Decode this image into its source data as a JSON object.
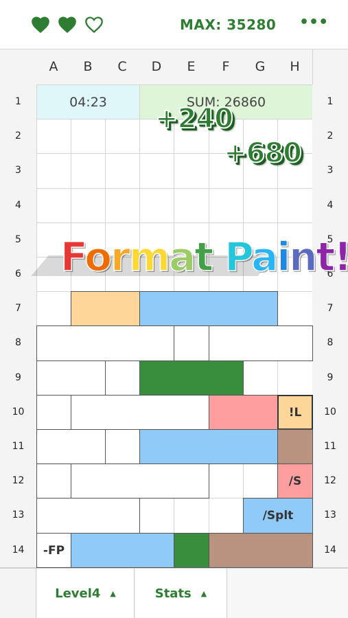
{
  "hearts": [
    {
      "name": "heart-full-icon",
      "filled": true
    },
    {
      "name": "heart-full-icon",
      "filled": true
    },
    {
      "name": "heart-empty-icon",
      "filled": false
    }
  ],
  "max_label": "MAX: 35280",
  "menu_icon": "more-icon",
  "columns": [
    "A",
    "B",
    "C",
    "D",
    "E",
    "F",
    "G",
    "H"
  ],
  "rows": [
    "1",
    "2",
    "3",
    "4",
    "5",
    "6",
    "7",
    "8",
    "9",
    "10",
    "11",
    "12",
    "13",
    "14"
  ],
  "timer": "04:23",
  "sum_label": "SUM: 26860",
  "score_popups": [
    "+240",
    "+680"
  ],
  "banner": {
    "text": "Format Paint!",
    "letters": [
      "F",
      "o",
      "r",
      "m",
      "a",
      "t",
      " ",
      "P",
      "a",
      "i",
      "n",
      "t",
      "!"
    ],
    "colors": [
      "#e53935",
      "#ef6c00",
      "#f9a825",
      "#fdd835",
      "#9ccc65",
      "#43a047",
      "#43a047",
      "#26c6da",
      "#29b6f6",
      "#1e88e5",
      "#5c6bc0",
      "#8e24aa",
      "#8e24aa"
    ]
  },
  "colors": {
    "accent": "#2e7d32",
    "orange": "#ffd699",
    "blue": "#90caf9",
    "green": "#388e3c",
    "pink": "#ff9e9e",
    "brown": "#b9937f",
    "white": "#ffffff",
    "timer_bg": "#e0f7fa",
    "sum_bg": "#dff5d8"
  },
  "blocks": [
    {
      "row": 7,
      "col": 2,
      "span": 2,
      "color": "orange",
      "label": ""
    },
    {
      "row": 7,
      "col": 4,
      "span": 4,
      "color": "blue",
      "label": ""
    },
    {
      "row": 8,
      "col": 1,
      "span": 4,
      "color": "white",
      "label": ""
    },
    {
      "row": 8,
      "col": 5,
      "span": 1,
      "color": "white",
      "label": ""
    },
    {
      "row": 8,
      "col": 6,
      "span": 3,
      "color": "white",
      "label": ""
    },
    {
      "row": 9,
      "col": 1,
      "span": 2,
      "color": "white",
      "label": ""
    },
    {
      "row": 9,
      "col": 3,
      "span": 1,
      "color": "white",
      "label": ""
    },
    {
      "row": 9,
      "col": 4,
      "span": 3,
      "color": "green",
      "label": ""
    },
    {
      "row": 10,
      "col": 1,
      "span": 1,
      "color": "white",
      "label": ""
    },
    {
      "row": 10,
      "col": 2,
      "span": 4,
      "color": "white",
      "label": ""
    },
    {
      "row": 10,
      "col": 6,
      "span": 2,
      "color": "pink",
      "label": ""
    },
    {
      "row": 10,
      "col": 8,
      "span": 1,
      "color": "orange",
      "label": "!L",
      "selected": true
    },
    {
      "row": 11,
      "col": 1,
      "span": 2,
      "color": "white",
      "label": ""
    },
    {
      "row": 11,
      "col": 3,
      "span": 1,
      "color": "white",
      "label": ""
    },
    {
      "row": 11,
      "col": 4,
      "span": 4,
      "color": "blue",
      "label": ""
    },
    {
      "row": 11,
      "col": 8,
      "span": 1,
      "color": "brown",
      "label": ""
    },
    {
      "row": 12,
      "col": 1,
      "span": 1,
      "color": "white",
      "label": ""
    },
    {
      "row": 12,
      "col": 2,
      "span": 4,
      "color": "white",
      "label": ""
    },
    {
      "row": 12,
      "col": 8,
      "span": 1,
      "color": "pink",
      "label": "/S"
    },
    {
      "row": 13,
      "col": 1,
      "span": 3,
      "color": "white",
      "label": ""
    },
    {
      "row": 13,
      "col": 7,
      "span": 2,
      "color": "blue",
      "label": "/Splt"
    },
    {
      "row": 14,
      "col": 1,
      "span": 1,
      "color": "white",
      "label": "-FP"
    },
    {
      "row": 14,
      "col": 2,
      "span": 3,
      "color": "blue",
      "label": ""
    },
    {
      "row": 14,
      "col": 5,
      "span": 1,
      "color": "green",
      "label": ""
    },
    {
      "row": 14,
      "col": 6,
      "span": 3,
      "color": "brown",
      "label": ""
    }
  ],
  "tabs": [
    {
      "label": "Level4",
      "icon": "triangle-up-icon"
    },
    {
      "label": "Stats",
      "icon": "triangle-up-icon"
    }
  ]
}
